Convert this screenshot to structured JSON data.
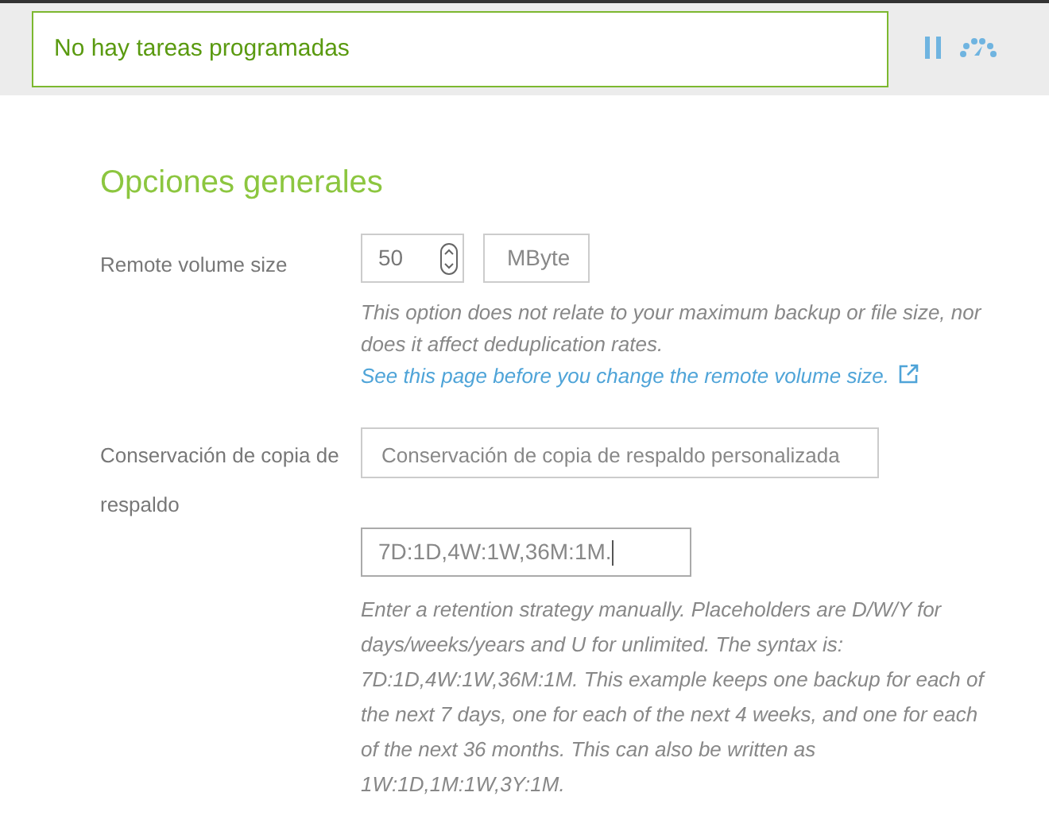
{
  "status_bar": {
    "message": "No hay tareas programadas",
    "paused": false
  },
  "section_title": "Opciones generales",
  "remote_volume": {
    "label": "Remote volume size",
    "value": "50",
    "unit": "MByte",
    "help": {
      "text": "This option does not relate to your maximum backup or file size, nor does it affect deduplication rates.",
      "link": "See this page before you change the remote volume size."
    }
  },
  "retention": {
    "label": "Conservación de copia de respaldo",
    "select_value": "Conservación de copia de respaldo personalizada",
    "value": "7D:1D,4W:1W,36M:1M.",
    "help": "Enter a retention strategy manually. Placeholders are D/W/Y for days/weeks/years and U for unlimited. The syntax is: 7D:1D,4W:1W,36M:1M. This example keeps one backup for each of the next 7 days, one for each of the next 4 weeks, and one for each of the next 36 months. This can also be written as 1W:1D,1M:1W,3Y:1M."
  }
}
